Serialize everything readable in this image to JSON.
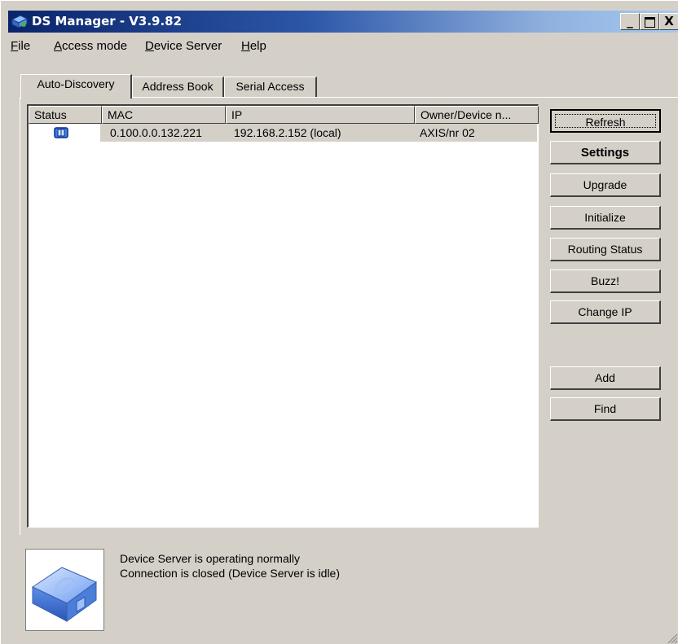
{
  "window": {
    "title": "DS Manager - V3.9.82",
    "minimize": "_",
    "maximize": "□",
    "close": "X"
  },
  "menu": [
    {
      "label": "File",
      "accel": "F",
      "rest": "ile"
    },
    {
      "label": "Access mode",
      "accel": "A",
      "rest": "ccess mode"
    },
    {
      "label": "Device Server",
      "accel": "D",
      "rest": "evice Server"
    },
    {
      "label": "Help",
      "accel": "H",
      "rest": "elp"
    }
  ],
  "tabs": [
    "Auto-Discovery",
    "Address Book",
    "Serial Access"
  ],
  "list": {
    "columns": [
      "Status",
      "MAC",
      "IP",
      "Owner/Device n..."
    ],
    "rows": [
      {
        "mac": "0.100.0.0.132.221",
        "ip": "192.168.2.152 (local)",
        "owner": "AXIS/nr 02",
        "status_icon": "device-server-icon"
      }
    ]
  },
  "buttons": {
    "refresh": "Refresh",
    "settings": "Settings",
    "upgrade": "Upgrade",
    "initialize": "Initialize",
    "routing_status": "Routing Status",
    "buzz": "Buzz!",
    "change_ip": "Change IP",
    "add": "Add",
    "find": "Find"
  },
  "status": {
    "line1": "Device Server is operating normally",
    "line2": "Connection is closed (Device Server is idle)",
    "icon": "device-server-icon"
  },
  "colors": {
    "titlebar_start": "#0a246a",
    "titlebar_end": "#a6caf0",
    "face": "#d4d0c8",
    "device_blue": "#3f7fe0"
  }
}
